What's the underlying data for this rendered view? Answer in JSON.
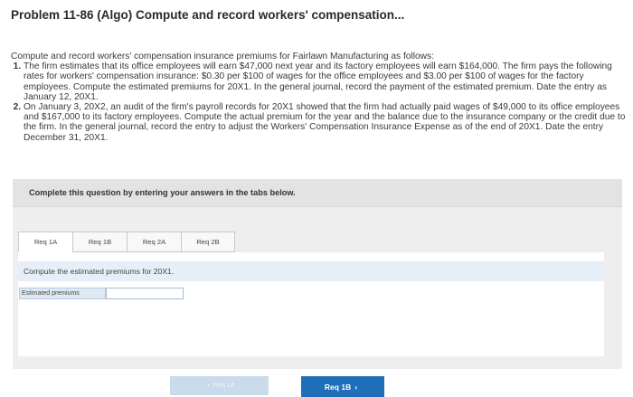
{
  "header": {
    "title": "Problem 11-86 (Algo) Compute and record workers' compensation..."
  },
  "problem": {
    "intro": "Compute and record workers' compensation insurance premiums for Fairlawn Manufacturing as follows:",
    "items": [
      "The firm estimates that its office employees will earn $47,000 next year and its factory employees will earn $164,000. The firm pays the following rates for workers' compensation insurance: $0.30 per $100 of wages for the office employees and $3.00 per $100 of wages for the factory employees. Compute the estimated premiums for 20X1. In the general journal, record the payment of the estimated premium. Date the entry as January 12, 20X1.",
      "On January 3, 20X2, an audit of the firm's payroll records for 20X1 showed that the firm had actually paid wages of $49,000 to its office employees and $167,000 to its factory employees. Compute the actual premium for the year and the balance due to the insurance company or the credit due to the firm. In the general journal, record the entry to adjust the Workers' Compensation Insurance Expense as of the end of 20X1. Date the entry December 31, 20X1."
    ]
  },
  "panel": {
    "instruction": "Complete this question by entering your answers in the tabs below.",
    "tabs": [
      "Req 1A",
      "Req 1B",
      "Req 2A",
      "Req 2B"
    ],
    "active_tab": "Req 1A",
    "question": "Compute the estimated premiums for 20X1.",
    "field_label": "Estimated premiums",
    "field_value": "",
    "prev_label": "Req 1A",
    "next_label": "Req 1B"
  },
  "colors": {
    "accent": "#1f6fb8",
    "disabled_button": "#c9daea",
    "question_band": "#e6eff7",
    "panel_bg": "#eeeeee"
  }
}
